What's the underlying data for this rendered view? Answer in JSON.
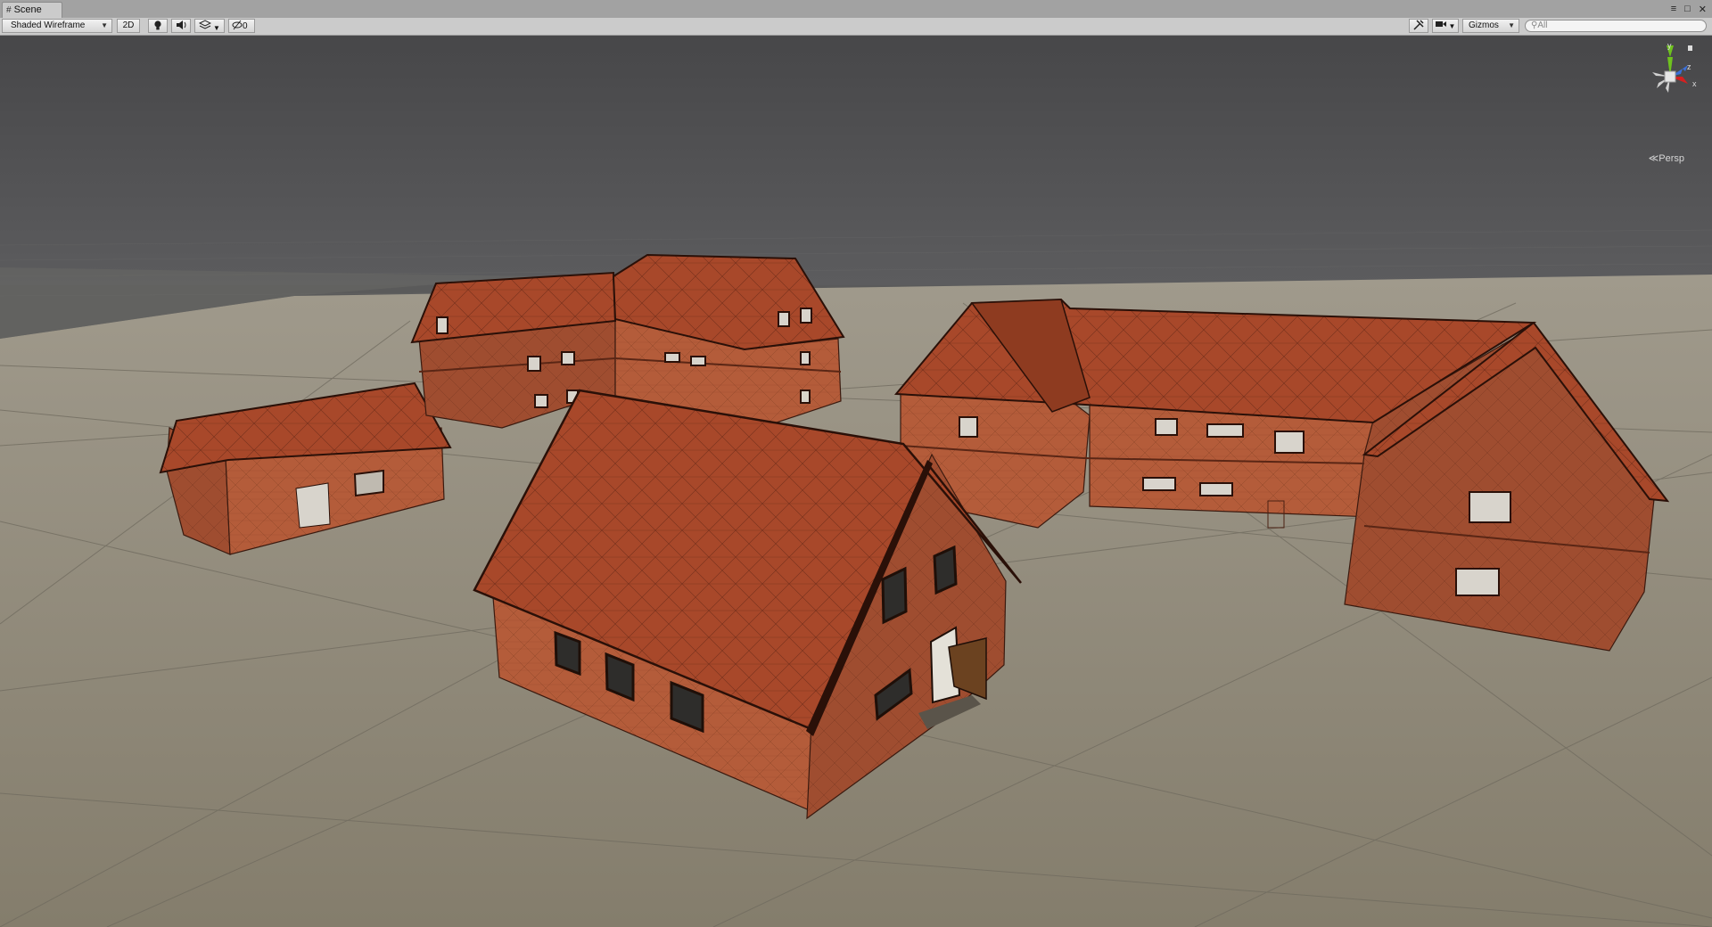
{
  "tab": {
    "title": "Scene",
    "icon": "scene-grid-icon"
  },
  "window_buttons": [
    "menu-icon",
    "maximize-icon",
    "close-icon"
  ],
  "toolbar": {
    "draw_mode": "Shaded Wireframe",
    "toggle_2d": "2D",
    "lighting_icon": "light-bulb-icon",
    "audio_icon": "speaker-icon",
    "effects_icon": "effects-layers-icon",
    "hidden_count": "0",
    "tools_icon": "scene-tools-icon",
    "camera_icon": "camera-icon",
    "gizmos_label": "Gizmos",
    "search_placeholder": "All"
  },
  "gizmo": {
    "y_label": "y",
    "z_label": "z",
    "x_label": "x",
    "projection_label": "Persp"
  },
  "colors": {
    "sky": "#4a4a4c",
    "ground": "#8e8776",
    "roof": "#a64a2a",
    "wall": "#b45c3a",
    "axis_y": "#6fc21e",
    "axis_z": "#3a6fd8",
    "axis_x": "#d52020"
  }
}
